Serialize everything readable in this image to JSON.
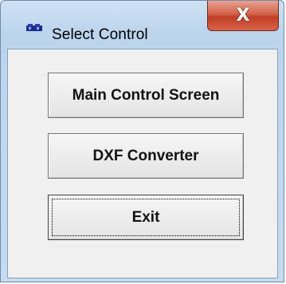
{
  "window": {
    "title": "Select Control",
    "close_label": "X"
  },
  "buttons": {
    "main_control": "Main Control Screen",
    "dxf_converter": "DXF Converter",
    "exit": "Exit"
  },
  "focused_button": "exit",
  "icons": {
    "app": "app-window-icon",
    "close": "close-icon"
  }
}
